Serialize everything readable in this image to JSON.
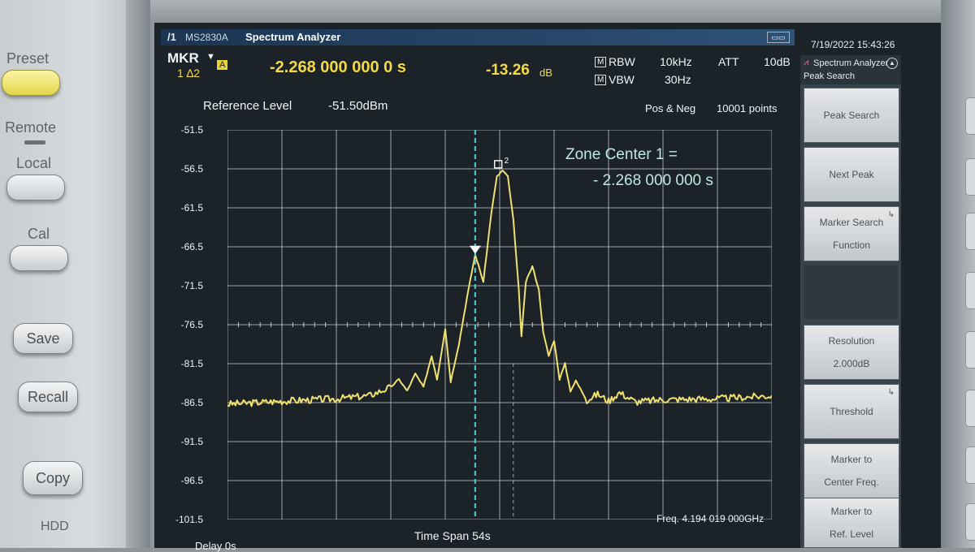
{
  "front_panel": {
    "preset": "Preset",
    "remote": "Remote",
    "local": "Local",
    "cal": "Cal",
    "save": "Save",
    "recall": "Recall",
    "copy": "Copy",
    "hdd": "HDD"
  },
  "window": {
    "logo": "/1",
    "model": "MS2830A",
    "title": "Spectrum Analyzer",
    "datetime": "7/19/2022 15:43:26"
  },
  "marker": {
    "label": "MKR",
    "mode_badge": "A",
    "index": "1 ∆2",
    "time": "-2.268 000 000 0 s",
    "level": "-13.26",
    "level_unit": "dB"
  },
  "settings": {
    "rbw_label": "RBW",
    "rbw": "10kHz",
    "vbw_label": "VBW",
    "vbw": "30Hz",
    "att_label": "ATT",
    "att": "10dB",
    "m_badge": "M"
  },
  "trace_header": {
    "ref_label": "Reference Level",
    "ref_value": "-51.50dBm",
    "detector": "Pos & Neg",
    "points": "10001 points"
  },
  "y_ticks": [
    "-51.5",
    "-56.5",
    "-61.5",
    "-66.5",
    "-71.5",
    "-76.5",
    "-81.5",
    "-86.5",
    "-91.5",
    "-96.5",
    "-101.5"
  ],
  "annotation": {
    "line1": "Zone Center 1 =",
    "line2": "- 2.268 000 000 s"
  },
  "footer": {
    "delay": "Delay 0s",
    "span": "Time Span 54s",
    "freq": "Freq. 4.194 019 000GHz"
  },
  "marker_labels": {
    "m1": "1",
    "m2": "2"
  },
  "colors": {
    "trace": "#f0e070",
    "marker_line": "#4fd0d8",
    "grid": "#c8ccce"
  },
  "softkeys": {
    "header_title": "Spectrum Analyzer",
    "header_sub": "Peak Search",
    "peak_search": "Peak Search",
    "next_peak": "Next Peak",
    "marker_search_1": "Marker Search",
    "marker_search_2": "Function",
    "resolution": "Resolution",
    "resolution_value": "2.000dB",
    "threshold": "Threshold",
    "mkr_center_1": "Marker to",
    "mkr_center_2": "Center Freq.",
    "mkr_ref_1": "Marker to",
    "mkr_ref_2": "Ref. Level"
  }
}
